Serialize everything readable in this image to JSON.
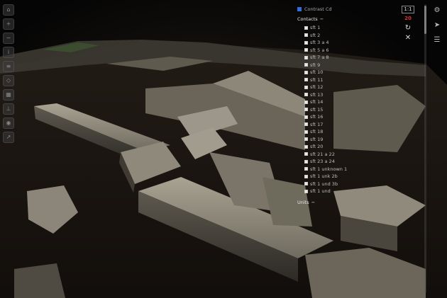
{
  "panel": {
    "title": "Contrast Cd",
    "contacts_label": "Contacts",
    "units_label": "Units",
    "items": [
      {
        "label": "sft 1"
      },
      {
        "label": "sft 2"
      },
      {
        "label": "sft 3 a 4"
      },
      {
        "label": "sft 5 a 6"
      },
      {
        "label": "sft 7 a 8"
      },
      {
        "label": "sft 9"
      },
      {
        "label": "sft 10"
      },
      {
        "label": "sft 11"
      },
      {
        "label": "sft 12"
      },
      {
        "label": "sft 13"
      },
      {
        "label": "sft 14"
      },
      {
        "label": "sft 15"
      },
      {
        "label": "sft 16"
      },
      {
        "label": "sft 17"
      },
      {
        "label": "sft 18"
      },
      {
        "label": "sft 19"
      },
      {
        "label": "sft 20"
      },
      {
        "label": "sft 21 a 22"
      },
      {
        "label": "sft 23 a 24"
      },
      {
        "label": "sft 1 unknown 1"
      },
      {
        "label": "sft 1 unk 2b"
      },
      {
        "label": "sft 1 und 3b"
      },
      {
        "label": "sft 1 und"
      }
    ]
  },
  "hud": {
    "scale": "1:1",
    "status": "20"
  },
  "colors": {
    "accent": "#2f6fdc",
    "alert": "#dd3333",
    "stone": "#8a8576"
  },
  "icons": {
    "left_tools": [
      "home-icon",
      "zoom-in-icon",
      "zoom-out-icon",
      "info-icon",
      "layers-icon",
      "measure-icon",
      "grid-icon",
      "ruler-icon",
      "camera-icon",
      "share-icon"
    ],
    "right_tools": [
      "settings-icon",
      "navigate-icon",
      "menu-icon"
    ]
  }
}
